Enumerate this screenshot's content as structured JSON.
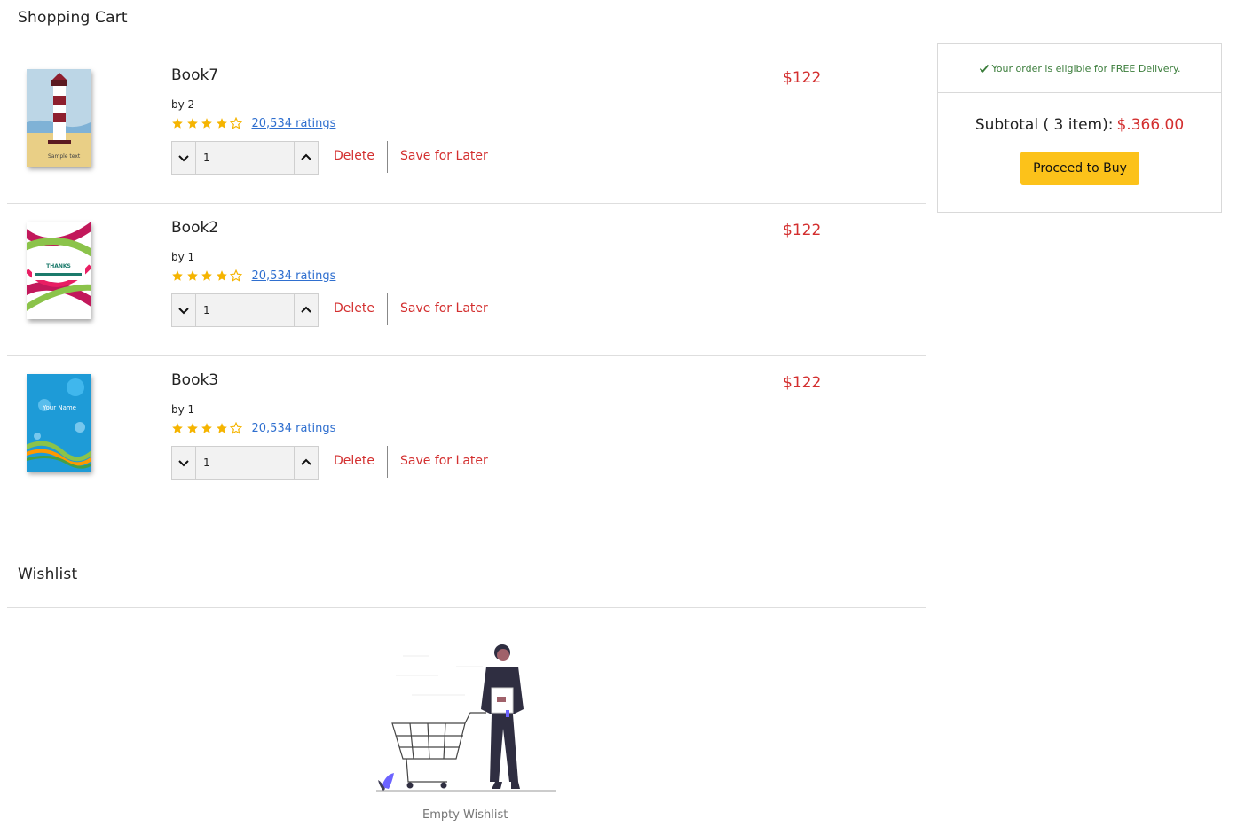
{
  "cart": {
    "title": "Shopping Cart",
    "items": [
      {
        "title": "Book7",
        "author": "by 2",
        "rating": 4,
        "max_rating": 5,
        "ratings_text": "20,534 ratings",
        "price": "$122",
        "quantity": "1",
        "delete_label": "Delete",
        "save_label": "Save for Later",
        "cover_text": "Sample text"
      },
      {
        "title": "Book2",
        "author": "by 1",
        "rating": 4,
        "max_rating": 5,
        "ratings_text": "20,534 ratings",
        "price": "$122",
        "quantity": "1",
        "delete_label": "Delete",
        "save_label": "Save for Later",
        "cover_text": "THANKS"
      },
      {
        "title": "Book3",
        "author": "by 1",
        "rating": 4,
        "max_rating": 5,
        "ratings_text": "20,534 ratings",
        "price": "$122",
        "quantity": "1",
        "delete_label": "Delete",
        "save_label": "Save for Later",
        "cover_text": "Your Name"
      }
    ]
  },
  "summary": {
    "delivery_note": "Your order is eligible for FREE Delivery.",
    "subtotal_label": "Subtotal ( 3 item):",
    "subtotal_amount": "$.366.00",
    "buy_label": "Proceed to Buy"
  },
  "wishlist": {
    "title": "Wishlist",
    "empty_text": "Empty Wishlist"
  },
  "colors": {
    "price": "#d32f2f",
    "link": "#2f6fcf",
    "star": "#f5b400",
    "buy_button": "#fcc21a",
    "delivery": "#3b7d3b"
  },
  "icons": {
    "decrease": "chevron-down-icon",
    "increase": "chevron-up-icon",
    "star": "star-icon",
    "check": "check-icon"
  }
}
